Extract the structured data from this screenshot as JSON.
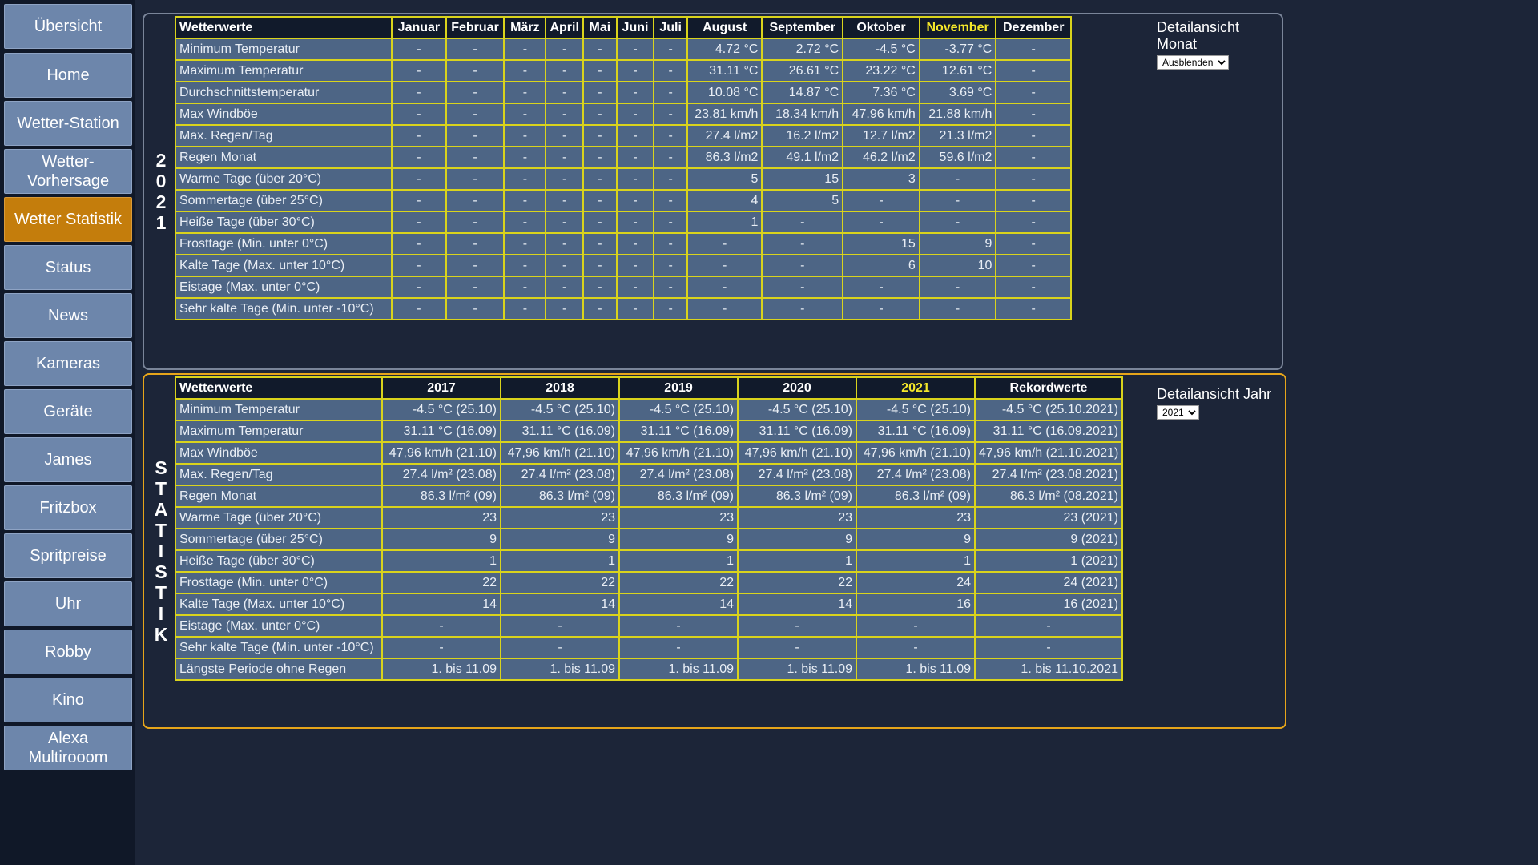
{
  "nav": [
    {
      "label": "Übersicht",
      "active": false
    },
    {
      "label": "Home",
      "active": false
    },
    {
      "label": "Wetter-Station",
      "active": false
    },
    {
      "label": "Wetter-\nVorhersage",
      "active": false
    },
    {
      "label": "Wetter Statistik",
      "active": true
    },
    {
      "label": "Status",
      "active": false
    },
    {
      "label": "News",
      "active": false
    },
    {
      "label": "Kameras",
      "active": false
    },
    {
      "label": "Geräte",
      "active": false
    },
    {
      "label": "James",
      "active": false
    },
    {
      "label": "Fritzbox",
      "active": false
    },
    {
      "label": "Spritpreise",
      "active": false
    },
    {
      "label": "Uhr",
      "active": false
    },
    {
      "label": "Robby",
      "active": false
    },
    {
      "label": "Kino",
      "active": false
    },
    {
      "label": "Alexa\nMultirooom",
      "active": false
    }
  ],
  "month_panel": {
    "vertical_label": [
      "2",
      "0",
      "2",
      "1"
    ],
    "detail_title": "Detailansicht Monat",
    "detail_select": "Ausblenden",
    "highlight_column": 10,
    "headers": [
      "Wetterwerte",
      "Januar",
      "Februar",
      "März",
      "April",
      "Mai",
      "Juni",
      "Juli",
      "August",
      "September",
      "Oktober",
      "November",
      "Dezember"
    ],
    "rows": [
      [
        "Minimum Temperatur",
        "-",
        "-",
        "-",
        "-",
        "-",
        "-",
        "-",
        "4.72 °C",
        "2.72 °C",
        "-4.5 °C",
        "-3.77 °C",
        "-"
      ],
      [
        "Maximum Temperatur",
        "-",
        "-",
        "-",
        "-",
        "-",
        "-",
        "-",
        "31.11 °C",
        "26.61 °C",
        "23.22 °C",
        "12.61 °C",
        "-"
      ],
      [
        "Durchschnittstemperatur",
        "-",
        "-",
        "-",
        "-",
        "-",
        "-",
        "-",
        "10.08 °C",
        "14.87 °C",
        "7.36 °C",
        "3.69 °C",
        "-"
      ],
      [
        "Max Windböe",
        "-",
        "-",
        "-",
        "-",
        "-",
        "-",
        "-",
        "23.81 km/h",
        "18.34 km/h",
        "47.96 km/h",
        "21.88 km/h",
        "-"
      ],
      [
        "Max. Regen/Tag",
        "-",
        "-",
        "-",
        "-",
        "-",
        "-",
        "-",
        "27.4 l/m2",
        "16.2 l/m2",
        "12.7 l/m2",
        "21.3 l/m2",
        "-"
      ],
      [
        "Regen Monat",
        "-",
        "-",
        "-",
        "-",
        "-",
        "-",
        "-",
        "86.3 l/m2",
        "49.1 l/m2",
        "46.2 l/m2",
        "59.6 l/m2",
        "-"
      ],
      [
        "Warme Tage (über 20°C)",
        "-",
        "-",
        "-",
        "-",
        "-",
        "-",
        "-",
        "5",
        "15",
        "3",
        "-",
        "-"
      ],
      [
        "Sommertage (über 25°C)",
        "-",
        "-",
        "-",
        "-",
        "-",
        "-",
        "-",
        "4",
        "5",
        "-",
        "-",
        "-"
      ],
      [
        "Heiße Tage (über 30°C)",
        "-",
        "-",
        "-",
        "-",
        "-",
        "-",
        "-",
        "1",
        "-",
        "-",
        "-",
        "-"
      ],
      [
        "Frosttage (Min. unter 0°C)",
        "-",
        "-",
        "-",
        "-",
        "-",
        "-",
        "-",
        "-",
        "-",
        "15",
        "9",
        "-"
      ],
      [
        "Kalte Tage (Max. unter 10°C)",
        "-",
        "-",
        "-",
        "-",
        "-",
        "-",
        "-",
        "-",
        "-",
        "6",
        "10",
        "-"
      ],
      [
        "Eistage (Max. unter 0°C)",
        "-",
        "-",
        "-",
        "-",
        "-",
        "-",
        "-",
        "-",
        "-",
        "-",
        "-",
        "-"
      ],
      [
        "Sehr kalte Tage (Min. unter -10°C)",
        "-",
        "-",
        "-",
        "-",
        "-",
        "-",
        "-",
        "-",
        "-",
        "-",
        "-",
        "-"
      ]
    ]
  },
  "year_panel": {
    "vertical_label": [
      "S",
      "T",
      "A",
      "T",
      "I",
      "S",
      "T",
      "I",
      "K"
    ],
    "detail_title": "Detailansicht Jahr",
    "detail_select": "2021",
    "highlight_column": 4,
    "headers": [
      "Wetterwerte",
      "2017",
      "2018",
      "2019",
      "2020",
      "2021",
      "Rekordwerte"
    ],
    "rows": [
      [
        "Minimum Temperatur",
        "-4.5 °C (25.10)",
        "-4.5 °C (25.10)",
        "-4.5 °C (25.10)",
        "-4.5 °C (25.10)",
        "-4.5 °C (25.10)",
        "-4.5 °C (25.10.2021)"
      ],
      [
        "Maximum Temperatur",
        "31.11 °C (16.09)",
        "31.11 °C (16.09)",
        "31.11 °C (16.09)",
        "31.11 °C (16.09)",
        "31.11 °C (16.09)",
        "31.11 °C (16.09.2021)"
      ],
      [
        "Max Windböe",
        "47,96 km/h (21.10)",
        "47,96 km/h (21.10)",
        "47,96 km/h (21.10)",
        "47,96 km/h (21.10)",
        "47,96 km/h (21.10)",
        "47,96 km/h (21.10.2021)"
      ],
      [
        "Max. Regen/Tag",
        "27.4 l/m² (23.08)",
        "27.4 l/m² (23.08)",
        "27.4 l/m² (23.08)",
        "27.4 l/m² (23.08)",
        "27.4 l/m² (23.08)",
        "27.4 l/m² (23.08.2021)"
      ],
      [
        "Regen Monat",
        "86.3 l/m² (09)",
        "86.3 l/m² (09)",
        "86.3 l/m² (09)",
        "86.3 l/m² (09)",
        "86.3 l/m² (09)",
        "86.3 l/m² (08.2021)"
      ],
      [
        "Warme Tage (über 20°C)",
        "23",
        "23",
        "23",
        "23",
        "23",
        "23 (2021)"
      ],
      [
        "Sommertage (über 25°C)",
        "9",
        "9",
        "9",
        "9",
        "9",
        "9 (2021)"
      ],
      [
        "Heiße Tage (über 30°C)",
        "1",
        "1",
        "1",
        "1",
        "1",
        "1 (2021)"
      ],
      [
        "Frosttage (Min. unter 0°C)",
        "22",
        "22",
        "22",
        "22",
        "24",
        "24 (2021)"
      ],
      [
        "Kalte Tage (Max. unter 10°C)",
        "14",
        "14",
        "14",
        "14",
        "16",
        "16 (2021)"
      ],
      [
        "Eistage (Max. unter 0°C)",
        "-",
        "-",
        "-",
        "-",
        "-",
        "-"
      ],
      [
        "Sehr kalte Tage (Min. unter -10°C)",
        "-",
        "-",
        "-",
        "-",
        "-",
        "-"
      ],
      [
        "Längste Periode ohne Regen",
        "1. bis 11.09",
        "1. bis 11.09",
        "1. bis 11.09",
        "1. bis 11.09",
        "1. bis 11.09",
        "1. bis 11.10.2021"
      ]
    ]
  }
}
